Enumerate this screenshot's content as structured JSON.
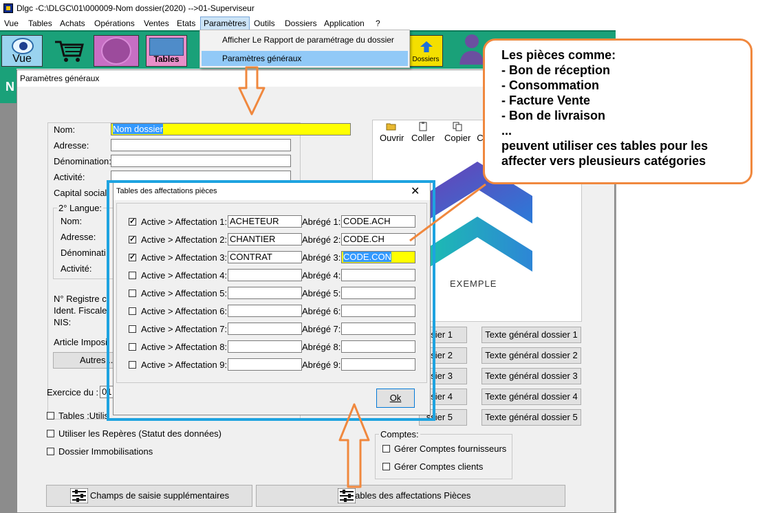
{
  "window": {
    "title": "Dlgc -C:\\DLGC\\01\\000009-Nom dossier(2020) -->01-Superviseur"
  },
  "menu": [
    "Vue",
    "Tables",
    "Achats",
    "Opérations",
    "Ventes",
    "Etats",
    "Paramètres",
    "Outils",
    "Dossiers",
    "Application",
    "?"
  ],
  "dropdown": {
    "item1": "Afficher Le Rapport de paramétrage du dossier",
    "item2": "Paramètres généraux"
  },
  "toolbar": {
    "vue": "Vue",
    "tables": "Tables",
    "dossiers": "Dossiers"
  },
  "background": {
    "letter": "N"
  },
  "main": {
    "title": "Paramètres généraux",
    "labels": {
      "nom": "Nom:",
      "adresse": "Adresse:",
      "denomination": "Dénomination:",
      "activite": "Activité:",
      "capital": "Capital social",
      "langue2": "2° Langue:",
      "l2_nom": "Nom:",
      "l2_adresse": "Adresse:",
      "l2_denomination": "Dénominati",
      "l2_activite": "Activité:",
      "registre": "N° Registre c",
      "ident_fiscale": "Ident. Fiscale",
      "nis": "NIS:",
      "article": "Article Imposi",
      "exercice": "Exercice du :",
      "exercice_value": "01",
      "comptes": "Comptes:"
    },
    "nom_value": "Nom dossier",
    "autres_button": "Autres ...",
    "image_tools": [
      "Ouvrir",
      "Coller",
      "Copier",
      "C"
    ],
    "image_caption": "EXEMPLE",
    "left_partial_buttons": [
      "ssier 1",
      "ssier 2",
      "ssier 3",
      "ssier 4",
      "ssier 5"
    ],
    "text_buttons": [
      "Texte général dossier 1",
      "Texte général dossier 2",
      "Texte général dossier 3",
      "Texte général dossier 4",
      "Texte général dossier 5"
    ],
    "checkboxes": {
      "tables": "Tables :Utilis",
      "reperes": "Utiliser les Repères (Statut des données)",
      "immobilisations": "Dossier Immobilisations",
      "fournisseurs": "Gérer Comptes fournisseurs",
      "clients": "Gérer Comptes clients"
    },
    "buttons": {
      "champs": "Champs de saisie supplémentaires",
      "tables_affect": "Tables des affectations Pièces"
    }
  },
  "dialog": {
    "title": "Tables des affectations pièces",
    "close": "✕",
    "ok": "Ok",
    "rows": [
      {
        "label": "Active > Affectation 1:",
        "value": "ACHETEUR",
        "abrege_label": "Abrégé 1:",
        "abrege": "CODE.ACH",
        "checked": true
      },
      {
        "label": "Active > Affectation 2:",
        "value": "CHANTIER",
        "abrege_label": "Abrégé 2:",
        "abrege": "CODE.CH",
        "checked": true
      },
      {
        "label": "Active > Affectation 3:",
        "value": "CONTRAT",
        "abrege_label": "Abrégé 3:",
        "abrege": "CODE.CON",
        "checked": true
      },
      {
        "label": "Active > Affectation 4:",
        "value": "",
        "abrege_label": "Abrégé 4:",
        "abrege": "",
        "checked": false
      },
      {
        "label": "Active > Affectation 5:",
        "value": "",
        "abrege_label": "Abrégé 5:",
        "abrege": "",
        "checked": false
      },
      {
        "label": "Active > Affectation 6:",
        "value": "",
        "abrege_label": "Abrégé 6:",
        "abrege": "",
        "checked": false
      },
      {
        "label": "Active > Affectation 7:",
        "value": "",
        "abrege_label": "Abrégé 7:",
        "abrege": "",
        "checked": false
      },
      {
        "label": "Active > Affectation 8:",
        "value": "",
        "abrege_label": "Abrégé 8:",
        "abrege": "",
        "checked": false
      },
      {
        "label": "Active > Affectation 9:",
        "value": "",
        "abrege_label": "Abrégé 9:",
        "abrege": "",
        "checked": false
      }
    ]
  },
  "callout": {
    "lines": [
      "Les pièces comme:",
      "- Bon de réception",
      "- Consommation",
      "- Facture Vente",
      "- Bon de livraison",
      "...",
      "peuvent utiliser ces  tables pour les",
      "affecter vers pleusieurs catégories"
    ]
  },
  "colors": {
    "accent_blue": "#1ea3e0",
    "annotation_orange": "#f0883e",
    "highlight_yellow": "#ffff00",
    "toolbar_green": "#1aa179"
  }
}
